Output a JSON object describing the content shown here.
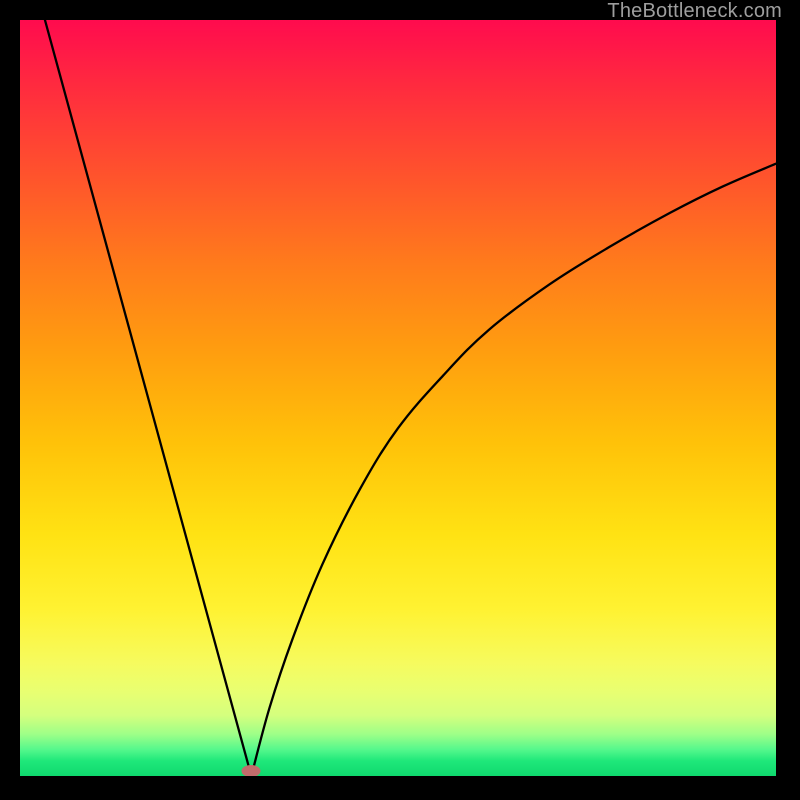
{
  "watermark": "TheBottleneck.com",
  "chart_data": {
    "type": "line",
    "title": "",
    "xlabel": "",
    "ylabel": "",
    "xlim": [
      0,
      100
    ],
    "ylim": [
      0,
      100
    ],
    "grid": false,
    "legend": false,
    "left_branch": {
      "comment": "Steep near-linear descent from top-left to the minimum",
      "x": [
        3.3,
        30.6
      ],
      "y": [
        100,
        0
      ]
    },
    "right_branch": {
      "comment": "Concave rise from the minimum toward ~81% at right edge; sampled",
      "x": [
        30.6,
        33,
        36,
        40,
        45,
        50,
        56,
        62,
        70,
        78,
        86,
        93,
        100
      ],
      "y": [
        0,
        9,
        18,
        28,
        38,
        46,
        53,
        59,
        65,
        70,
        74.5,
        78,
        81
      ]
    },
    "minimum": {
      "x": 30.6,
      "y": 0
    },
    "marker": {
      "x": 30.6,
      "y": 0.7,
      "color": "#c16c6c"
    },
    "background": {
      "type": "vertical-gradient",
      "stops": [
        {
          "pos": 0.0,
          "color": "#ff0b4e"
        },
        {
          "pos": 0.2,
          "color": "#ff512d"
        },
        {
          "pos": 0.44,
          "color": "#ff9e0f"
        },
        {
          "pos": 0.68,
          "color": "#ffe213"
        },
        {
          "pos": 0.89,
          "color": "#e8ff72"
        },
        {
          "pos": 1.0,
          "color": "#0fd96e"
        }
      ]
    }
  }
}
